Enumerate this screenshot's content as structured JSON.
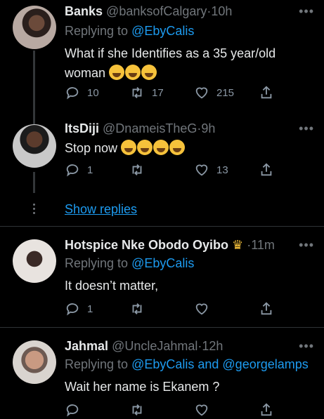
{
  "tweets": [
    {
      "name": "Banks",
      "handle": "@banksofCalgary",
      "time": "10h",
      "replying_label": "Replying to",
      "replying_to": "@EbyCalis",
      "text": "What if she Identifies as a 35 year/old woman",
      "emojis": [
        "😭",
        "😭",
        "😭"
      ],
      "replies": "10",
      "retweets": "17",
      "likes": "215"
    },
    {
      "name": "ItsDiji",
      "handle": "@DnameisTheG",
      "time": "9h",
      "text": "Stop now",
      "emojis": [
        "😂",
        "😂",
        "😭",
        "😭"
      ],
      "replies": "1",
      "retweets": "",
      "likes": "13"
    },
    {
      "name": "Hotspice Nke Obodo Oyibo",
      "handle": "",
      "time": "11m",
      "replying_label": "Replying to",
      "replying_to": "@EbyCalis",
      "text": "It doesn’t matter,",
      "replies": "1",
      "retweets": "",
      "likes": ""
    },
    {
      "name": "Jahmal",
      "handle": "@UncleJahmal",
      "time": "12h",
      "replying_label": "Replying to",
      "replying_to": "@EbyCalis and @georgelamps",
      "text": "Wait her name is Ekanem ?",
      "replies": "",
      "retweets": "",
      "likes": ""
    }
  ],
  "show_replies": "Show replies",
  "more_icon": "•••",
  "dot": "·"
}
